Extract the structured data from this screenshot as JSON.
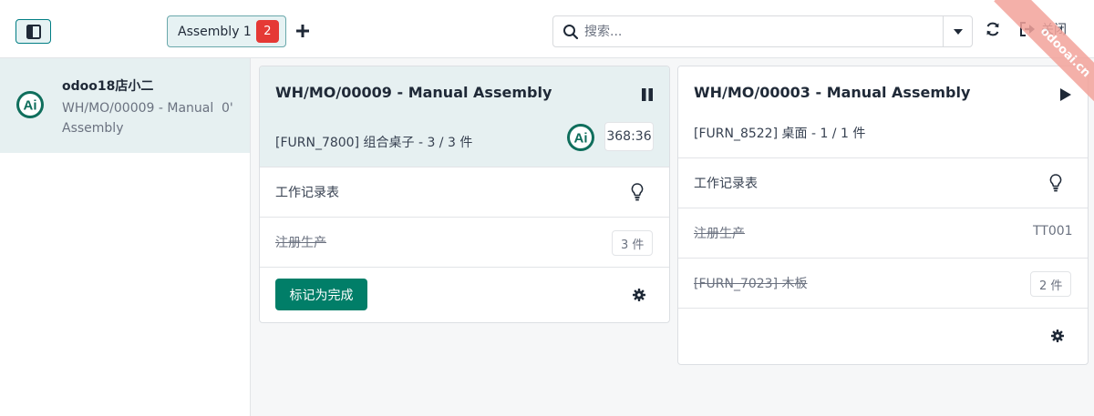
{
  "toolbar": {
    "tab_label": "Assembly 1",
    "tab_badge": "2",
    "search_placeholder": "搜索...",
    "close_label": "关闭",
    "watermark": "odooai.cn"
  },
  "sidebar": {
    "operator_name": "odoo18店小二",
    "operator_desc": "WH/MO/00009 - Manual Assembly",
    "operator_time": "0'"
  },
  "cards": [
    {
      "title": "WH/MO/00009 - Manual Assembly",
      "product": "[FURN_7800] 组合桌子 - 3 / 3 件",
      "timer": "368:36",
      "worksheet": "工作记录表",
      "register": "注册生产",
      "register_qty": "3 件",
      "done_label": "标记为完成"
    },
    {
      "title": "WH/MO/00003 - Manual Assembly",
      "product": "[FURN_8522] 桌面 - 1 / 1 件",
      "worksheet": "工作记录表",
      "register": "注册生产",
      "register_lot": "TT001",
      "component": "[FURN_7023] 木板",
      "component_qty": "2 件"
    }
  ],
  "colors": {
    "primary": "#017e84",
    "button": "#017e68",
    "badge": "#e53935",
    "active_bg": "#e6f0f1"
  },
  "icons": [
    "sidebar-toggle-icon",
    "plus-icon",
    "search-icon",
    "caret-down-icon",
    "refresh-icon",
    "sign-out-icon",
    "pause-icon",
    "play-icon",
    "lightbulb-icon",
    "gear-icon",
    "avatar-icon"
  ]
}
